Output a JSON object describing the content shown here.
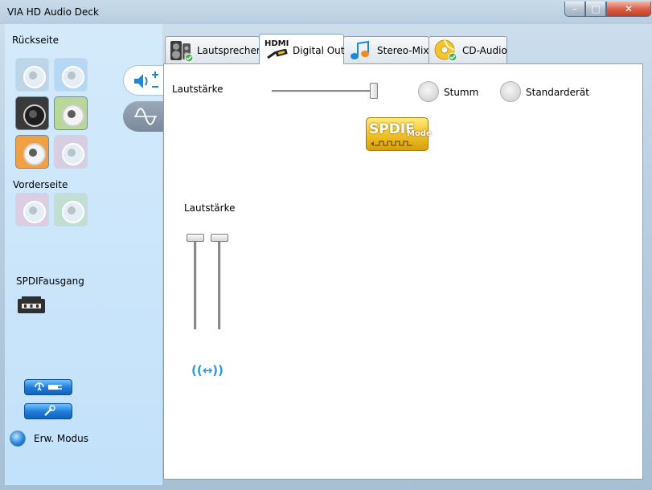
{
  "window": {
    "title": "VIA HD Audio Deck",
    "caption": {
      "minimize": "–",
      "maximize": "□",
      "close": "✕"
    }
  },
  "left_panel": {
    "rear_label": "Rückseite",
    "rear_jacks": [
      {
        "name": "rear-jack-1",
        "color": "#a8c4d8",
        "state": "inactive"
      },
      {
        "name": "rear-jack-2",
        "color": "#9cc8f0",
        "state": "inactive"
      },
      {
        "name": "rear-jack-3",
        "color": "#3a3a3a",
        "state": "active"
      },
      {
        "name": "rear-jack-4",
        "color": "#b8d89a",
        "state": "active"
      },
      {
        "name": "rear-jack-5",
        "color": "#f0a040",
        "state": "active"
      },
      {
        "name": "rear-jack-6",
        "color": "#e0b8cc",
        "state": "inactive"
      }
    ],
    "front_label": "Vorderseite",
    "front_jacks": [
      {
        "name": "front-jack-1",
        "color": "#e8b8cc",
        "state": "inactive"
      },
      {
        "name": "front-jack-2",
        "color": "#b8d8b0",
        "state": "inactive"
      }
    ],
    "spdif_label": "SPDIFausgang",
    "mode_label": "Erw. Modus"
  },
  "tabs": [
    {
      "label": "Lautsprecher",
      "icon": "speaker-icon",
      "active": false
    },
    {
      "label": "Digital Out",
      "icon": "hdmi-icon",
      "badge": "HDMI",
      "active": true
    },
    {
      "label": "Stereo-Mix",
      "icon": "music-note-icon",
      "active": false
    },
    {
      "label": "CD-Audio",
      "icon": "cd-icon",
      "active": false
    }
  ],
  "digital_out": {
    "volume_label": "Lautstärke",
    "volume_level": 1.0,
    "mute_label": "Stumm",
    "default_label": "Standarderät",
    "spdif_badge": "SPDIF",
    "spdif_badge_sub": "Mode",
    "channel_volume_label": "Lautstärke",
    "channel_left_level": 1.0,
    "channel_right_level": 1.0,
    "link_icon": "((↔))"
  },
  "colors": {
    "accent": "#1e7ad8",
    "panel": "#c8e4fb",
    "link": "#2a9ad8"
  }
}
